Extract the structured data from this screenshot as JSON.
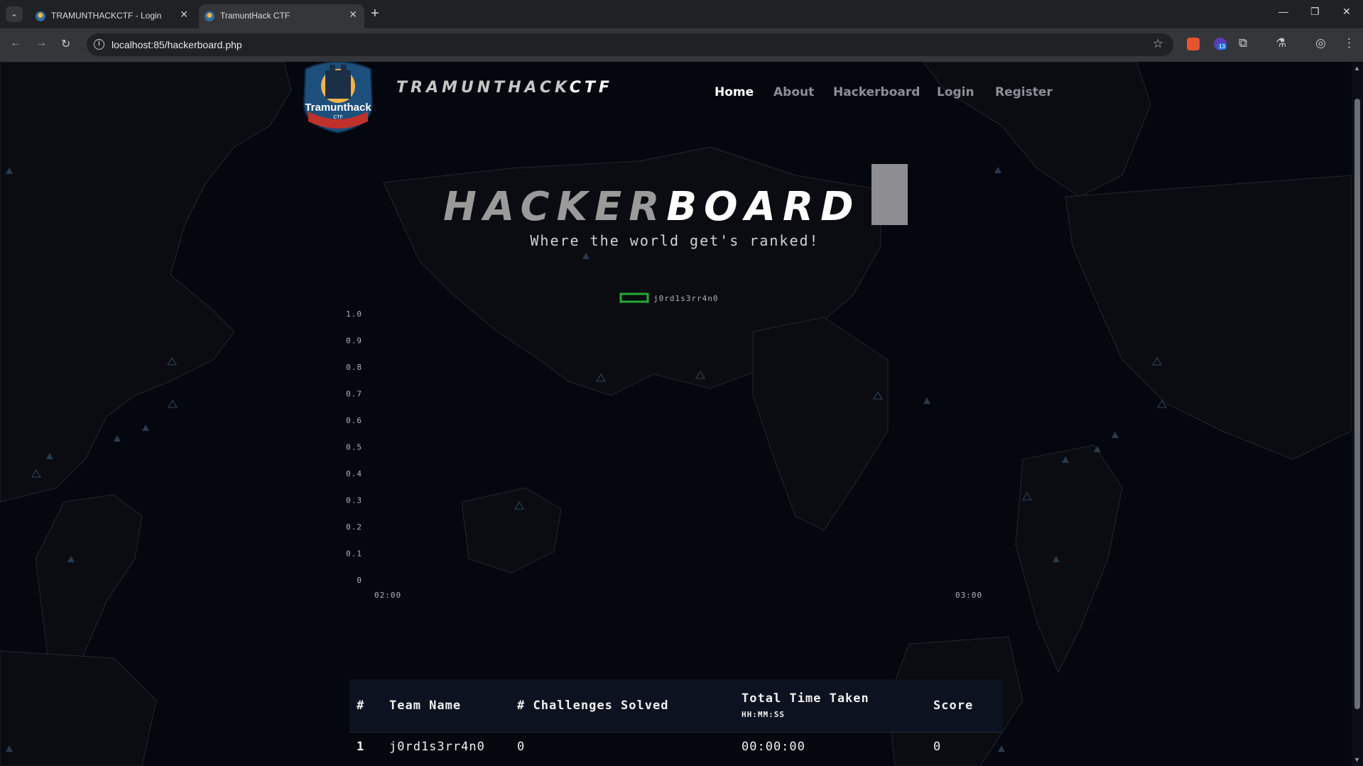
{
  "browser": {
    "tabs": [
      {
        "title": "TRAMUNTHACKCTF - Login",
        "active": false
      },
      {
        "title": "TramuntHack CTF",
        "active": true
      }
    ],
    "url": "localhost:85/hackerboard.php",
    "extension_badge": "13"
  },
  "site": {
    "brand_prefix": "TRAMUNTHACK",
    "brand_suffix": "CTF",
    "logo_text": "Tramunthack",
    "logo_subtext": "CTF",
    "nav": [
      {
        "label": "Home",
        "active": true
      },
      {
        "label": "About",
        "active": false
      },
      {
        "label": "Hackerboard",
        "active": false
      },
      {
        "label": "Login",
        "active": false
      },
      {
        "label": "Register",
        "active": false
      }
    ]
  },
  "hero": {
    "title_part1": "HACKER",
    "title_part2": "BOARD",
    "subtitle": "Where the world get's ranked!"
  },
  "chart_data": {
    "type": "line",
    "series": [
      {
        "name": "j0rd1s3rr4n0",
        "color": "#22aa33",
        "points": []
      }
    ],
    "x_ticks": [
      "02:00",
      "03:00"
    ],
    "y_ticks": [
      "1.0",
      "0.9",
      "0.8",
      "0.7",
      "0.6",
      "0.5",
      "0.4",
      "0.3",
      "0.2",
      "0.1",
      "0"
    ],
    "ylim": [
      0,
      1
    ],
    "legend_position": "top-center"
  },
  "scoreboard": {
    "headers": {
      "rank": "#",
      "team": "Team Name",
      "solved": "# Challenges Solved",
      "time": "Total Time Taken",
      "time_format": "HH:MM:SS",
      "score": "Score"
    },
    "rows": [
      {
        "rank": "1",
        "team": "j0rd1s3rr4n0",
        "solved": "0",
        "time": "00:00:00",
        "score": "0"
      }
    ]
  }
}
